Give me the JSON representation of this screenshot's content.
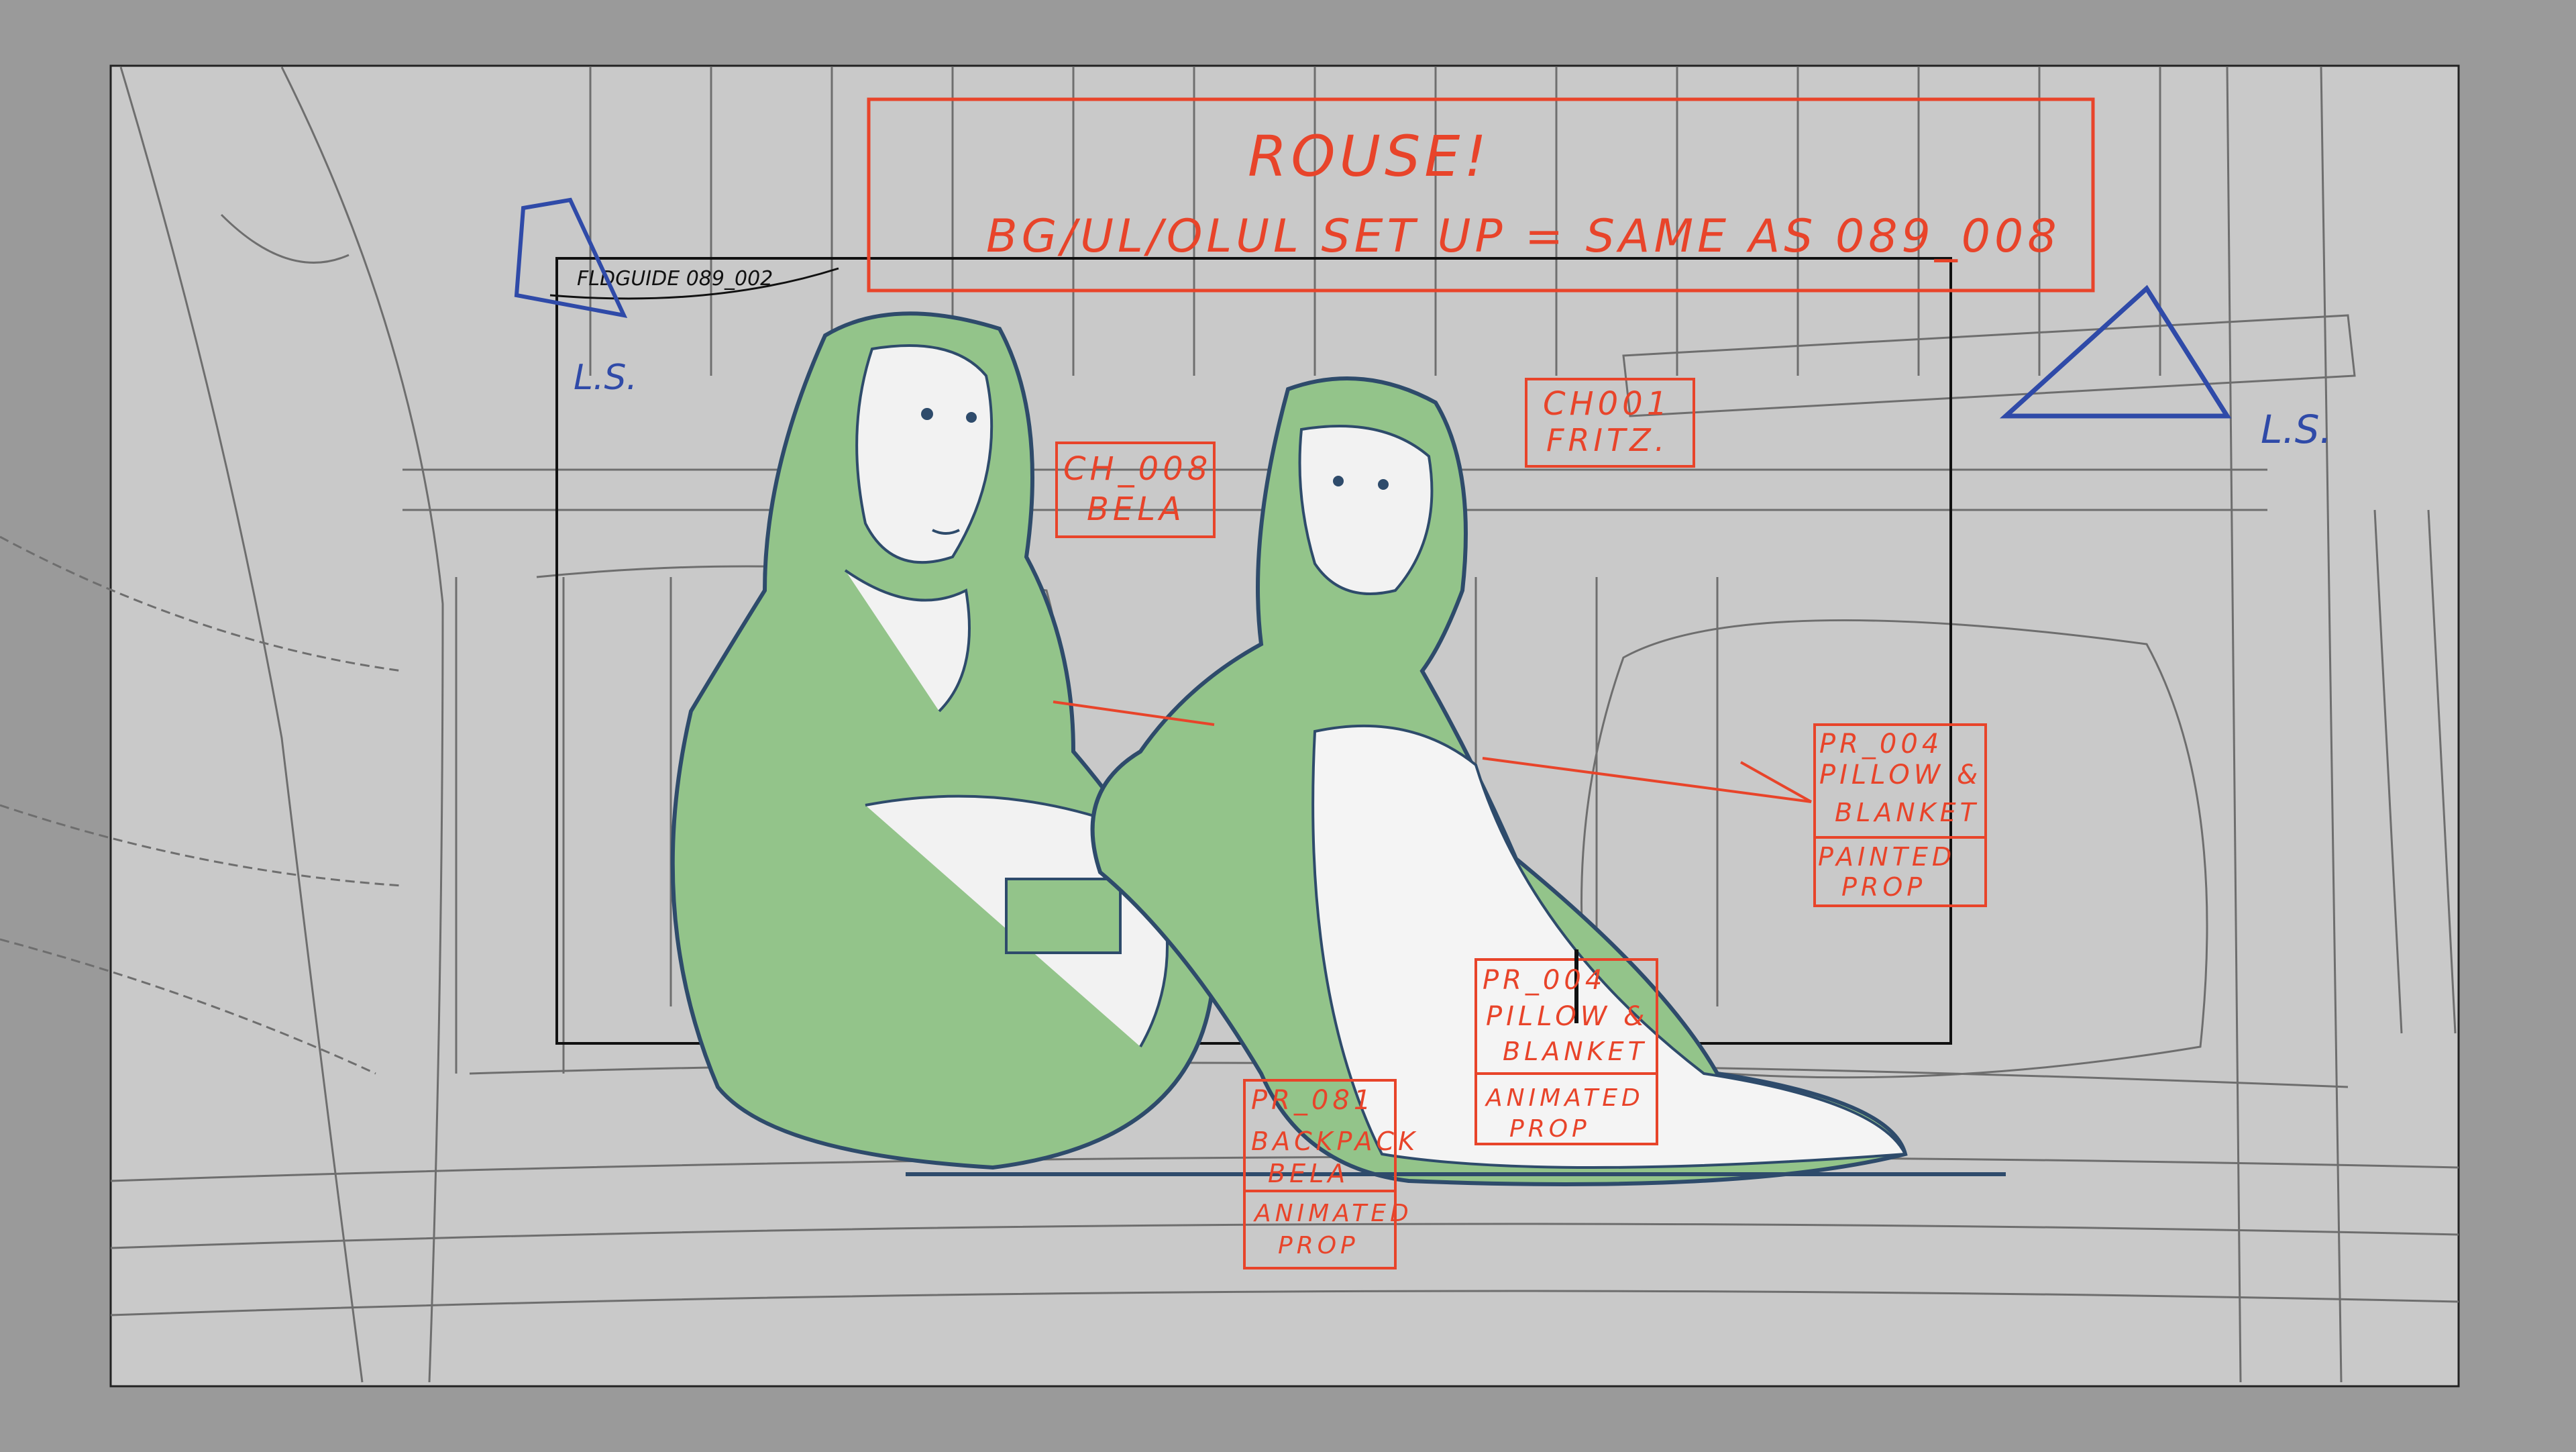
{
  "colors": {
    "outer_bg": "#8a8a8a",
    "frame_bg": "#c4c4c4",
    "sketch_line": "#555555",
    "annotation_red": "#e8442a",
    "annotation_blue": "#2f4aa8",
    "character_fill": "#93c48a",
    "character_line": "#2e4b6b",
    "cam_frame": "#111111"
  },
  "annotations": {
    "header_title": "ROUSE!",
    "header_note": "BG/UL/OLUL SET UP = SAME AS 089_008",
    "field_guide": "FLDGUIDE 089_002",
    "ls_left": "L.S.",
    "ls_right": "L.S."
  },
  "tags": {
    "ch008": {
      "line1": "CH_008",
      "line2": "BELA"
    },
    "ch001": {
      "line1": "CH001",
      "line2": "FRITZ."
    },
    "pr004a": {
      "line1": "PR_004",
      "line2": "PILLOW &",
      "line3": "BLANKET",
      "line4": "PAINTED",
      "line5": "PROP"
    },
    "pr004b": {
      "line1": "PR_004",
      "line2": "PILLOW &",
      "line3": "BLANKET",
      "line4": "ANIMATED",
      "line5": "PROP"
    },
    "pr081": {
      "line1": "PR_081",
      "line2": "BACKPACK",
      "line3": "BELA",
      "line4": "ANIMATED",
      "line5": "PROP"
    }
  }
}
